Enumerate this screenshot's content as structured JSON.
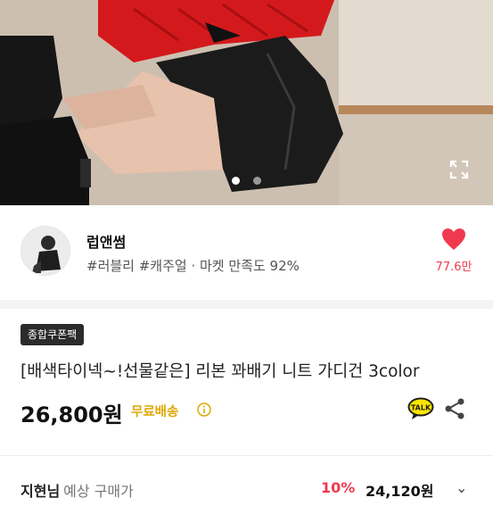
{
  "hero": {
    "slide_count": 2,
    "active_slide": 1,
    "expand_icon": "expand-icon"
  },
  "seller": {
    "name": "럽앤썸",
    "tags": "#러블리 #캐주얼 · 마켓 만족도 92%",
    "likes": "77.6만",
    "heart_icon": "heart-icon",
    "accent_color": "#f0394f"
  },
  "product": {
    "badge": "종합쿠폰팩",
    "title": "[배색타이넥~!선물같은] 리본 꽈배기 니트 가디건 3color",
    "price": "26,800원",
    "shipping": "무료배송",
    "shipping_color": "#e0a800"
  },
  "estimate": {
    "buyer": "지현님",
    "label": "예상 구매가",
    "discount": "10%",
    "final_price": "24,120원"
  }
}
